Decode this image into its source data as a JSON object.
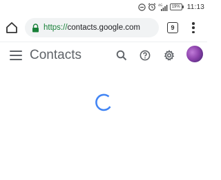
{
  "status_bar": {
    "time": "11:13",
    "battery": "19%",
    "network": "4G",
    "icons": [
      "minus-circle-icon",
      "alarm-icon",
      "network-signal-icon",
      "battery-icon"
    ]
  },
  "browser": {
    "url_scheme": "https://",
    "url_host": "contacts.google.com",
    "tab_count": "9",
    "icons": [
      "home-icon",
      "lock-icon",
      "tab-switcher-icon",
      "more-vert-icon"
    ],
    "colors": {
      "secure_green": "#188038",
      "pill_bg": "#f1f3f4"
    }
  },
  "app_bar": {
    "title": "Contacts",
    "icons": [
      "hamburger-menu-icon",
      "search-icon",
      "help-icon",
      "settings-icon",
      "account-avatar"
    ]
  },
  "main": {
    "loading": true,
    "spinner_color": "#4285f4"
  }
}
